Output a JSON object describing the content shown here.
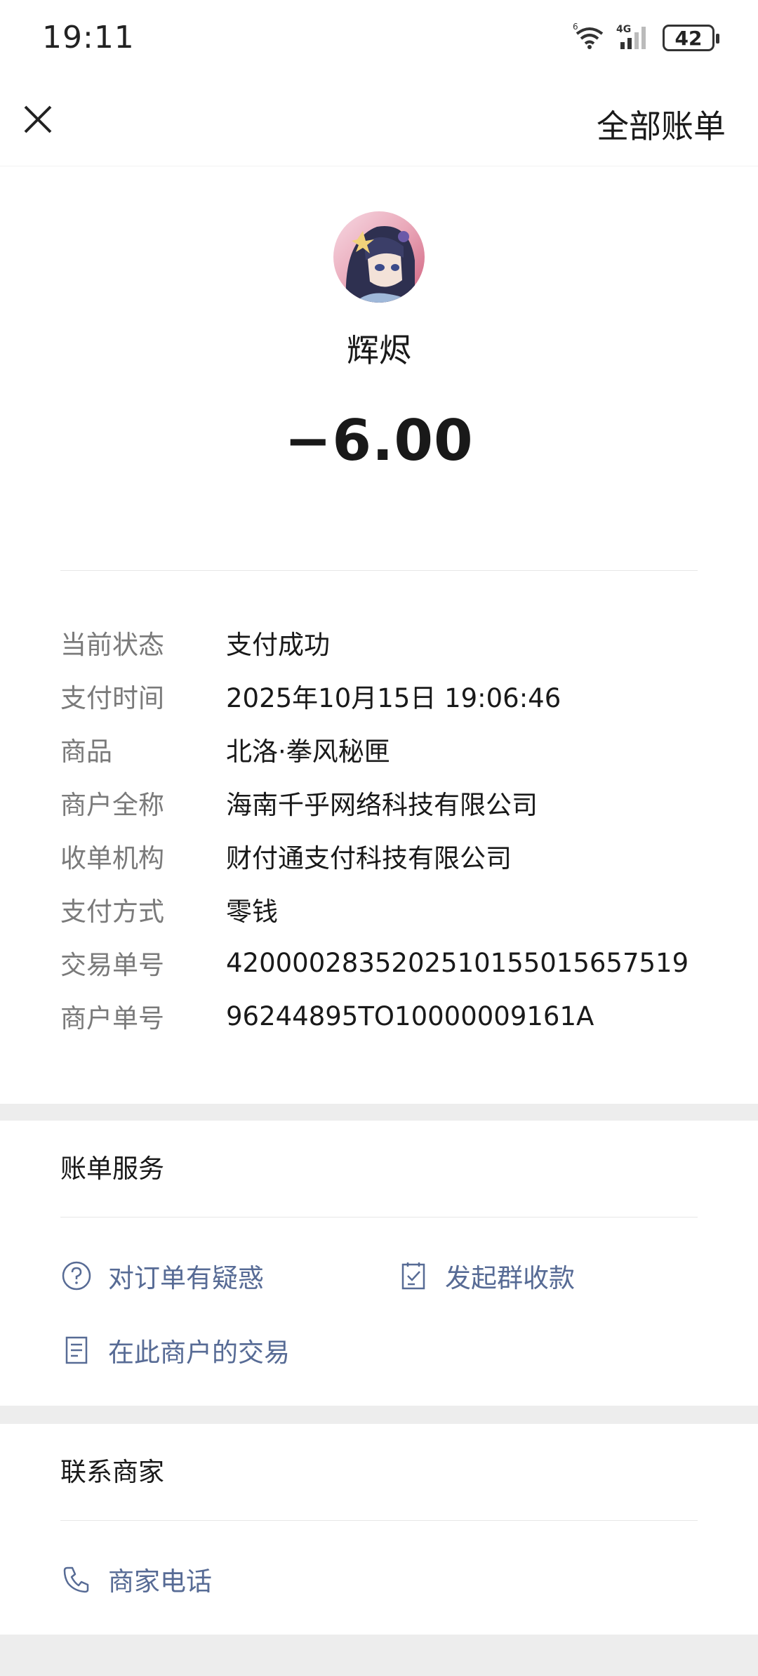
{
  "status_bar": {
    "time": "19:11",
    "network_label": "4G",
    "battery_level": "42",
    "icons": [
      "wifi-6-icon",
      "cellular-signal-icon",
      "battery-icon"
    ]
  },
  "nav": {
    "close_icon": "close-icon",
    "all_bills_label": "全部账单"
  },
  "transaction": {
    "merchant_name": "辉烬",
    "amount": "−6.00",
    "details": [
      {
        "label": "当前状态",
        "value": "支付成功"
      },
      {
        "label": "支付时间",
        "value": "2025年10月15日 19:06:46"
      },
      {
        "label": "商品",
        "value": "北洛·拳风秘匣"
      },
      {
        "label": "商户全称",
        "value": "海南千乎网络科技有限公司"
      },
      {
        "label": "收单机构",
        "value": "财付通支付科技有限公司"
      },
      {
        "label": "支付方式",
        "value": "零钱"
      },
      {
        "label": "交易单号",
        "value": "4200002835202510155015657519"
      },
      {
        "label": "商户单号",
        "value": "96244895TO10000009161A"
      }
    ]
  },
  "bill_service": {
    "title": "账单服务",
    "actions": [
      {
        "label": "对订单有疑惑",
        "icon": "question-circle-icon"
      },
      {
        "label": "发起群收款",
        "icon": "checklist-icon"
      },
      {
        "label": "在此商户的交易",
        "icon": "document-icon"
      }
    ]
  },
  "contact": {
    "title": "联系商家",
    "actions": [
      {
        "label": "商家电话",
        "icon": "phone-icon"
      }
    ]
  },
  "colors": {
    "page_background": "#ededed",
    "card_background": "#ffffff",
    "link_blue": "#576b95",
    "label_gray": "#7a7a7a",
    "text_black": "#191919"
  }
}
